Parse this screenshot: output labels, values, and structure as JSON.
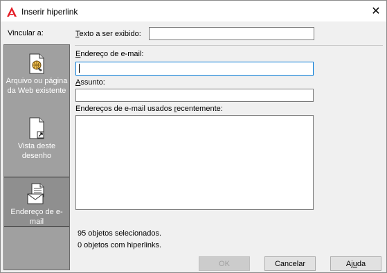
{
  "window": {
    "title": "Inserir hiperlink",
    "close_glyph": "✕",
    "app_icon": "autocad-a-icon",
    "accent": "#e51b24"
  },
  "left": {
    "header": "Vincular a:",
    "items": [
      {
        "label": "Arquivo ou página da Web existente",
        "icon": "web-page-icon",
        "active": false
      },
      {
        "label": "Vista deste desenho",
        "icon": "drawing-view-icon",
        "active": false
      },
      {
        "label": "Endereço de e-mail",
        "icon": "email-icon",
        "active": true
      }
    ]
  },
  "form": {
    "display_text_label_u": "T",
    "display_text_label_rest": "exto a ser exibido:",
    "display_text_value": "",
    "email_label_u": "E",
    "email_label_rest": "ndereço de e-mail:",
    "email_value": "",
    "subject_label_u": "A",
    "subject_label_rest": "ssunto:",
    "subject_value": "",
    "recent_label_pre": "Endereços de e-mail usados ",
    "recent_label_u": "r",
    "recent_label_post": "ecentemente:",
    "recent_items": []
  },
  "status": {
    "selected": "95 objetos selecionados.",
    "with_links": "0 objetos com hiperlinks."
  },
  "buttons": {
    "ok": "OK",
    "cancel": "Cancelar",
    "help_pre": "Aj",
    "help_u": "u",
    "help_post": "da"
  }
}
